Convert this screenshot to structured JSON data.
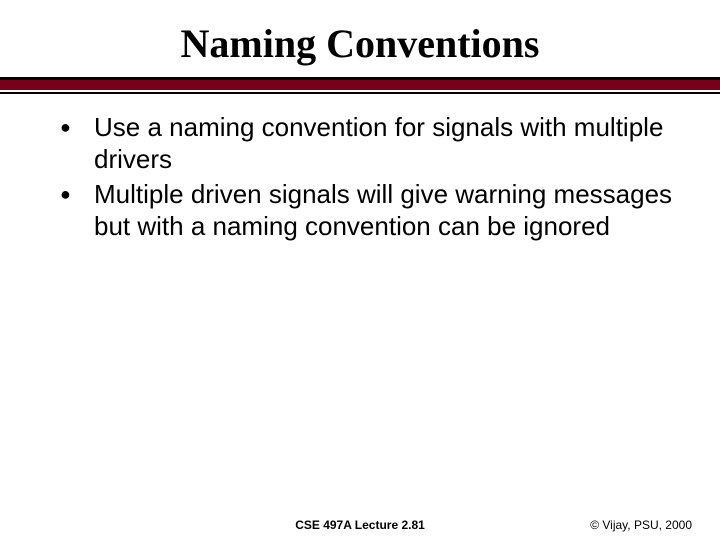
{
  "title": "Naming Conventions",
  "bullets": [
    "Use a naming convention for signals with multiple drivers",
    "Multiple driven signals will give warning messages but with a naming convention can be ignored"
  ],
  "footer": {
    "center": "CSE 497A Lecture 2.81",
    "right": "© Vijay, PSU, 2000"
  }
}
